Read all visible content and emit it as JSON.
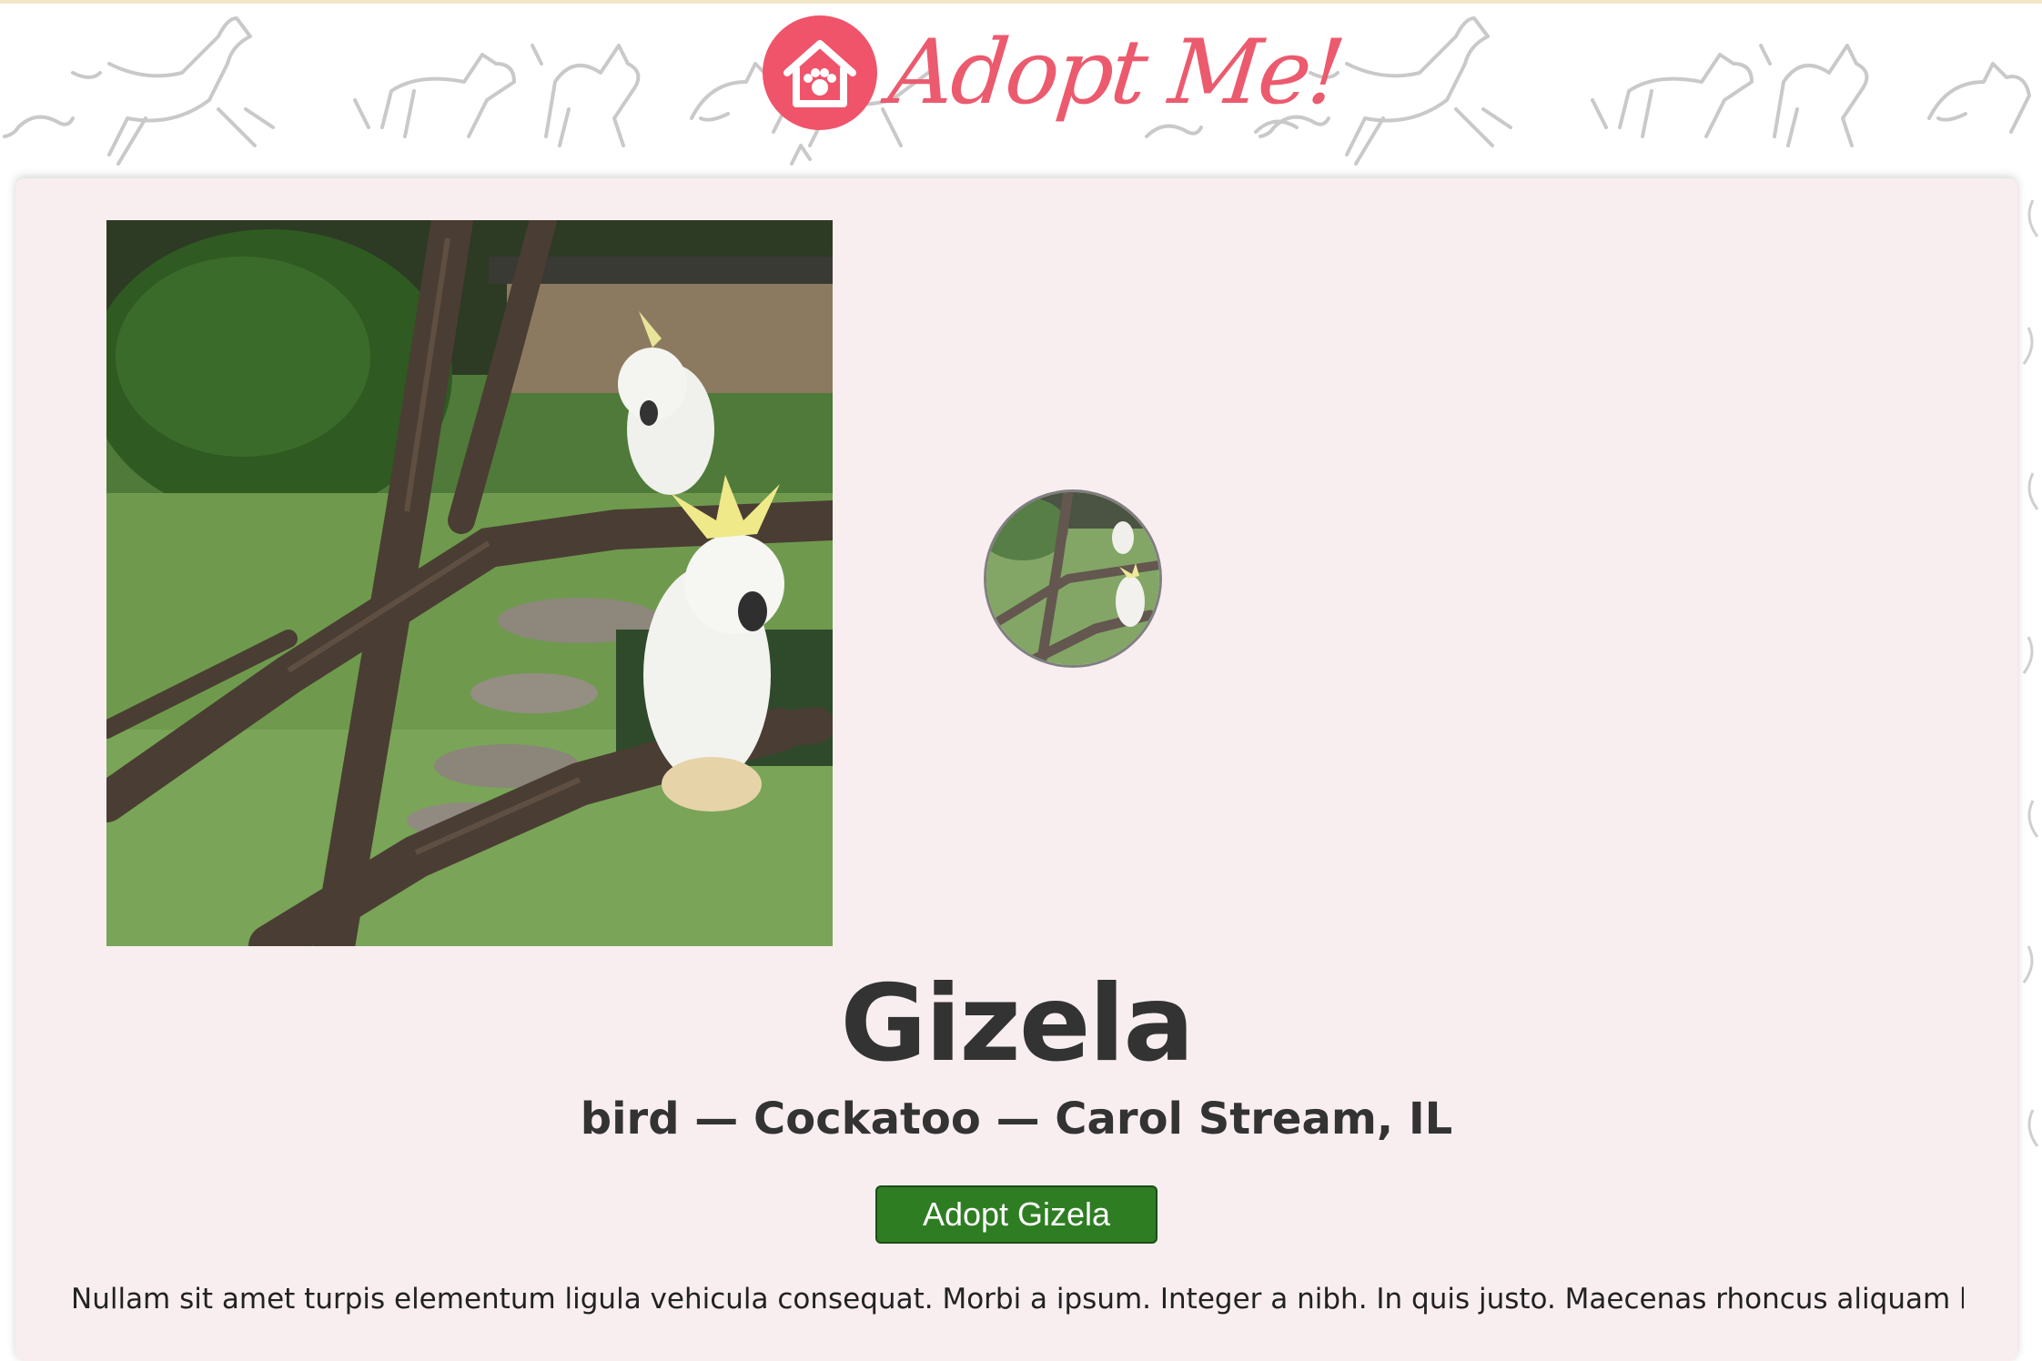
{
  "header": {
    "logo_text": "Adopt Me!",
    "logo_icon": "house-paw-icon",
    "background_pattern": "line-art-animals"
  },
  "pet": {
    "name": "Gizela",
    "meta": "bird — Cockatoo — Carol Stream, IL",
    "adopt_button_label": "Adopt Gizela",
    "hero_image": "cockatoos-on-branches-photo",
    "thumbnail_image": "cockatoos-on-branches-thumbnail",
    "description": "Nullam sit amet turpis elementum ligula vehicula consequat. Morbi a ipsum. Integer a nibh. In quis justo. Maecenas rhoncus aliquam lacus. Morbi"
  },
  "colors": {
    "brand": "#ec5a6e",
    "card_background": "#f8eef0",
    "button": "#2f7d23",
    "text": "#333333"
  }
}
